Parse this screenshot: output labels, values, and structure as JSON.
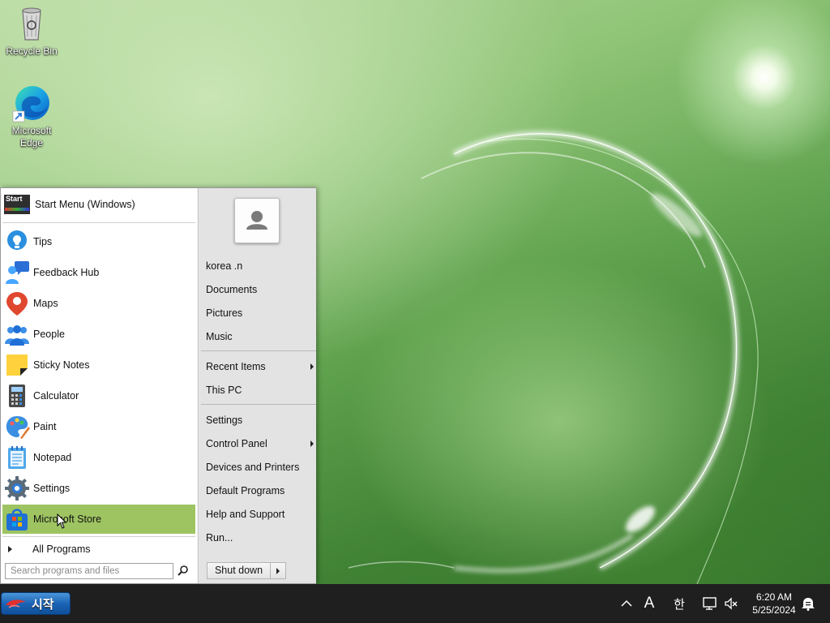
{
  "desktop": {
    "icons": [
      {
        "label": "Recycle Bin"
      },
      {
        "label": "Microsoft Edge"
      }
    ]
  },
  "start_menu": {
    "header_title": "Start Menu (Windows)",
    "header_icon_text": "Start",
    "programs": [
      {
        "label": "Tips",
        "icon": "tips-icon"
      },
      {
        "label": "Feedback Hub",
        "icon": "feedback-hub-icon"
      },
      {
        "label": "Maps",
        "icon": "maps-icon"
      },
      {
        "label": "People",
        "icon": "people-icon"
      },
      {
        "label": "Sticky Notes",
        "icon": "sticky-notes-icon"
      },
      {
        "label": "Calculator",
        "icon": "calculator-icon"
      },
      {
        "label": "Paint",
        "icon": "paint-icon"
      },
      {
        "label": "Notepad",
        "icon": "notepad-icon"
      },
      {
        "label": "Settings",
        "icon": "settings-icon"
      },
      {
        "label": "Microsoft Store",
        "icon": "store-icon",
        "selected": true
      }
    ],
    "all_programs": "All Programs",
    "search_placeholder": "Search programs and files",
    "right": {
      "user": "korea .n",
      "documents": "Documents",
      "pictures": "Pictures",
      "music": "Music",
      "recent_items": "Recent Items",
      "this_pc": "This PC",
      "settings": "Settings",
      "control_panel": "Control Panel",
      "devices_printers": "Devices and Printers",
      "default_programs": "Default Programs",
      "help_support": "Help and Support",
      "run": "Run...",
      "shutdown": "Shut down"
    },
    "selection_color": "#9ec462"
  },
  "taskbar": {
    "start_label": "시작",
    "tray": {
      "font_indicator": "A",
      "ime_indicator": "한"
    },
    "clock": {
      "time": "6:20 AM",
      "date": "5/25/2024"
    }
  }
}
